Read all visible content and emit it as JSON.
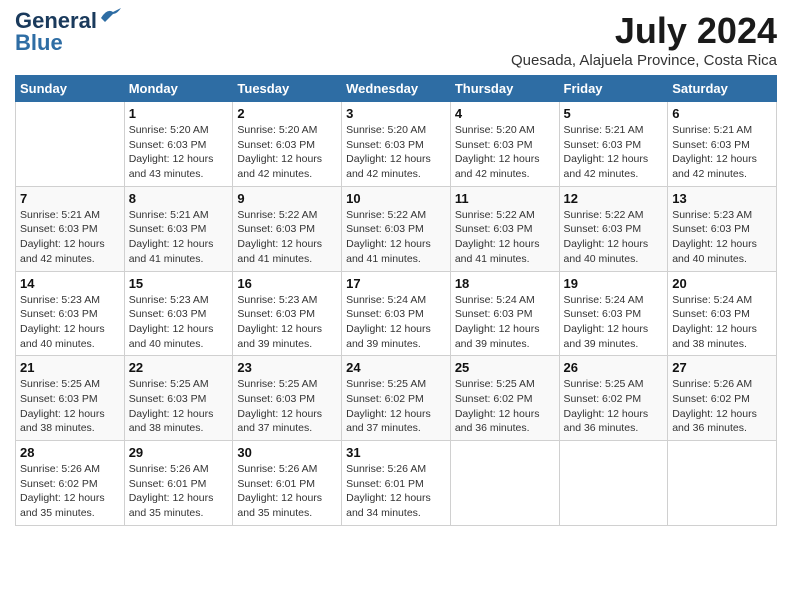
{
  "header": {
    "logo_line1": "General",
    "logo_line2": "Blue",
    "month_year": "July 2024",
    "location": "Quesada, Alajuela Province, Costa Rica"
  },
  "weekdays": [
    "Sunday",
    "Monday",
    "Tuesday",
    "Wednesday",
    "Thursday",
    "Friday",
    "Saturday"
  ],
  "weeks": [
    [
      {
        "day": "",
        "info": ""
      },
      {
        "day": "1",
        "info": "Sunrise: 5:20 AM\nSunset: 6:03 PM\nDaylight: 12 hours\nand 43 minutes."
      },
      {
        "day": "2",
        "info": "Sunrise: 5:20 AM\nSunset: 6:03 PM\nDaylight: 12 hours\nand 42 minutes."
      },
      {
        "day": "3",
        "info": "Sunrise: 5:20 AM\nSunset: 6:03 PM\nDaylight: 12 hours\nand 42 minutes."
      },
      {
        "day": "4",
        "info": "Sunrise: 5:20 AM\nSunset: 6:03 PM\nDaylight: 12 hours\nand 42 minutes."
      },
      {
        "day": "5",
        "info": "Sunrise: 5:21 AM\nSunset: 6:03 PM\nDaylight: 12 hours\nand 42 minutes."
      },
      {
        "day": "6",
        "info": "Sunrise: 5:21 AM\nSunset: 6:03 PM\nDaylight: 12 hours\nand 42 minutes."
      }
    ],
    [
      {
        "day": "7",
        "info": "Sunrise: 5:21 AM\nSunset: 6:03 PM\nDaylight: 12 hours\nand 42 minutes."
      },
      {
        "day": "8",
        "info": "Sunrise: 5:21 AM\nSunset: 6:03 PM\nDaylight: 12 hours\nand 41 minutes."
      },
      {
        "day": "9",
        "info": "Sunrise: 5:22 AM\nSunset: 6:03 PM\nDaylight: 12 hours\nand 41 minutes."
      },
      {
        "day": "10",
        "info": "Sunrise: 5:22 AM\nSunset: 6:03 PM\nDaylight: 12 hours\nand 41 minutes."
      },
      {
        "day": "11",
        "info": "Sunrise: 5:22 AM\nSunset: 6:03 PM\nDaylight: 12 hours\nand 41 minutes."
      },
      {
        "day": "12",
        "info": "Sunrise: 5:22 AM\nSunset: 6:03 PM\nDaylight: 12 hours\nand 40 minutes."
      },
      {
        "day": "13",
        "info": "Sunrise: 5:23 AM\nSunset: 6:03 PM\nDaylight: 12 hours\nand 40 minutes."
      }
    ],
    [
      {
        "day": "14",
        "info": "Sunrise: 5:23 AM\nSunset: 6:03 PM\nDaylight: 12 hours\nand 40 minutes."
      },
      {
        "day": "15",
        "info": "Sunrise: 5:23 AM\nSunset: 6:03 PM\nDaylight: 12 hours\nand 40 minutes."
      },
      {
        "day": "16",
        "info": "Sunrise: 5:23 AM\nSunset: 6:03 PM\nDaylight: 12 hours\nand 39 minutes."
      },
      {
        "day": "17",
        "info": "Sunrise: 5:24 AM\nSunset: 6:03 PM\nDaylight: 12 hours\nand 39 minutes."
      },
      {
        "day": "18",
        "info": "Sunrise: 5:24 AM\nSunset: 6:03 PM\nDaylight: 12 hours\nand 39 minutes."
      },
      {
        "day": "19",
        "info": "Sunrise: 5:24 AM\nSunset: 6:03 PM\nDaylight: 12 hours\nand 39 minutes."
      },
      {
        "day": "20",
        "info": "Sunrise: 5:24 AM\nSunset: 6:03 PM\nDaylight: 12 hours\nand 38 minutes."
      }
    ],
    [
      {
        "day": "21",
        "info": "Sunrise: 5:25 AM\nSunset: 6:03 PM\nDaylight: 12 hours\nand 38 minutes."
      },
      {
        "day": "22",
        "info": "Sunrise: 5:25 AM\nSunset: 6:03 PM\nDaylight: 12 hours\nand 38 minutes."
      },
      {
        "day": "23",
        "info": "Sunrise: 5:25 AM\nSunset: 6:03 PM\nDaylight: 12 hours\nand 37 minutes."
      },
      {
        "day": "24",
        "info": "Sunrise: 5:25 AM\nSunset: 6:02 PM\nDaylight: 12 hours\nand 37 minutes."
      },
      {
        "day": "25",
        "info": "Sunrise: 5:25 AM\nSunset: 6:02 PM\nDaylight: 12 hours\nand 36 minutes."
      },
      {
        "day": "26",
        "info": "Sunrise: 5:25 AM\nSunset: 6:02 PM\nDaylight: 12 hours\nand 36 minutes."
      },
      {
        "day": "27",
        "info": "Sunrise: 5:26 AM\nSunset: 6:02 PM\nDaylight: 12 hours\nand 36 minutes."
      }
    ],
    [
      {
        "day": "28",
        "info": "Sunrise: 5:26 AM\nSunset: 6:02 PM\nDaylight: 12 hours\nand 35 minutes."
      },
      {
        "day": "29",
        "info": "Sunrise: 5:26 AM\nSunset: 6:01 PM\nDaylight: 12 hours\nand 35 minutes."
      },
      {
        "day": "30",
        "info": "Sunrise: 5:26 AM\nSunset: 6:01 PM\nDaylight: 12 hours\nand 35 minutes."
      },
      {
        "day": "31",
        "info": "Sunrise: 5:26 AM\nSunset: 6:01 PM\nDaylight: 12 hours\nand 34 minutes."
      },
      {
        "day": "",
        "info": ""
      },
      {
        "day": "",
        "info": ""
      },
      {
        "day": "",
        "info": ""
      }
    ]
  ]
}
